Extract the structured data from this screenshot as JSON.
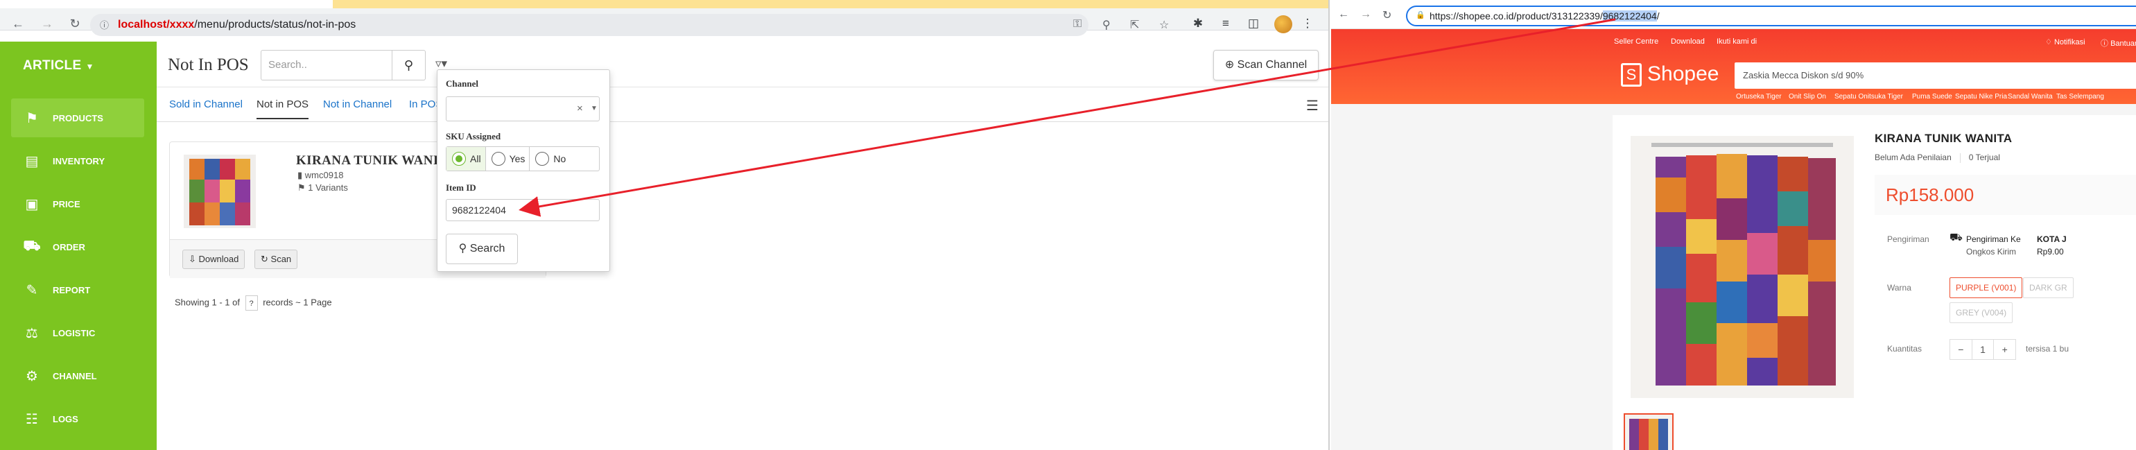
{
  "left_browser": {
    "url": "/menu/products/status/not-in-pos",
    "url_redacted": "localhost/xxxx"
  },
  "sidebar": {
    "brand": "ARTICLE",
    "items": [
      {
        "label": "PRODUCTS",
        "icon": "tag-icon"
      },
      {
        "label": "INVENTORY",
        "icon": "inventory-icon"
      },
      {
        "label": "PRICE",
        "icon": "money-icon"
      },
      {
        "label": "ORDER",
        "icon": "cart-icon"
      },
      {
        "label": "REPORT",
        "icon": "clipboard-icon"
      },
      {
        "label": "LOGISTIC",
        "icon": "dolly-icon"
      },
      {
        "label": "CHANNEL",
        "icon": "gear-icon"
      },
      {
        "label": "LOGS",
        "icon": "file-icon"
      }
    ]
  },
  "header": {
    "title": "Not In POS",
    "search_placeholder": "Search..",
    "scan_channel": "Scan Channel"
  },
  "tabs": [
    "Sold in Channel",
    "Not in POS",
    "Not in Channel",
    "In POS"
  ],
  "product": {
    "name": "KIRANA TUNIK WANITA",
    "sku": "wmc0918",
    "variants": "1 Variants",
    "download": "Download",
    "scan": "Scan"
  },
  "pagination": {
    "prefix": "Showing 1 - 1 of",
    "total": "?",
    "suffix": "records ~ 1 Page"
  },
  "filter": {
    "channel_label": "Channel",
    "sku_label": "SKU Assigned",
    "sku_options": [
      "All",
      "Yes",
      "No"
    ],
    "sku_selected": "All",
    "item_id_label": "Item ID",
    "item_id_value": "9682122404",
    "search_label": "Search"
  },
  "right_browser": {
    "url_prefix": "https://shopee.co.id/product/313122339/",
    "url_highlight": "9682122404",
    "url_suffix": "/"
  },
  "shopee": {
    "top_links": [
      "Seller Centre",
      "Download",
      "Ikuti kami di",
      "Notifikasi",
      "Bantuan"
    ],
    "logo": "Shopee",
    "search_placeholder": "Zaskia Mecca Diskon s/d 90%",
    "suggestions": [
      "Ortuseka Tiger",
      "Onit Slip On",
      "Sepatu Onitsuka Tiger",
      "Puma Suede",
      "Sepatu Nike Pria",
      "Sandal Wanita",
      "Tas Selempang"
    ],
    "title": "KIRANA TUNIK WANITA",
    "no_rating": "Belum Ada Penilaian",
    "sold": "0",
    "sold_label": "Terjual",
    "price": "Rp158.000",
    "shipping_label": "Pengiriman",
    "shipping_to": "Pengiriman Ke",
    "shipping_city": "KOTA J",
    "shipping_cost_label": "Ongkos Kirim",
    "shipping_cost": "Rp9.00",
    "color_label": "Warna",
    "colors": [
      "PURPLE (V001)",
      "DARK GR",
      "GREY (V004)"
    ],
    "qty_label": "Kuantitas",
    "qty_value": "1",
    "stock_text": "tersisa 1 bu"
  },
  "colors": {
    "sidebar_green": "#7cc520",
    "link_blue": "#1a73c9",
    "shopee_orange": "#ee4d2d",
    "arrow_red": "#e8202a"
  }
}
